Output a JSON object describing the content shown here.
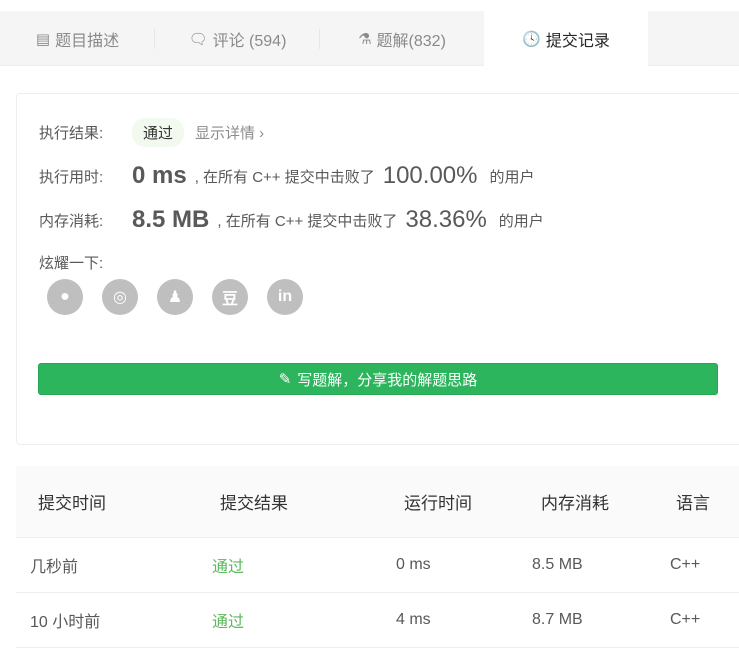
{
  "tabs": [
    {
      "label": "题目描述",
      "icon": "description-icon"
    },
    {
      "label": "评论 (594)",
      "icon": "comment-icon"
    },
    {
      "label": "题解(832)",
      "icon": "flask-icon"
    },
    {
      "label": "提交记录",
      "icon": "clock-icon"
    }
  ],
  "result": {
    "label": "执行结果:",
    "status": "通过",
    "detail": "显示详情 ›",
    "runtime_label": "执行用时:",
    "runtime": "0 ms",
    "runtime_mid": ", 在所有 C++ 提交中击败了",
    "runtime_pct": "100.00%",
    "suffix": "的用户",
    "memory_label": "内存消耗:",
    "memory": "8.5 MB",
    "memory_mid": ", 在所有 C++ 提交中击败了",
    "memory_pct": "38.36%",
    "share_label": "炫耀一下:",
    "share_icons": [
      "wechat-icon",
      "weibo-icon",
      "qq-icon",
      "douban-icon",
      "linkedin-icon"
    ],
    "write_button": "写题解，分享我的解题思路"
  },
  "table": {
    "headers": [
      "提交时间",
      "提交结果",
      "运行时间",
      "内存消耗",
      "语言"
    ],
    "rows": [
      [
        "几秒前",
        "通过",
        "0 ms",
        "8.5 MB",
        "C++"
      ],
      [
        "10 小时前",
        "通过",
        "4 ms",
        "8.7 MB",
        "C++"
      ]
    ]
  },
  "colors": {
    "accent": "#2db55d",
    "pass": "#5cb85c"
  }
}
